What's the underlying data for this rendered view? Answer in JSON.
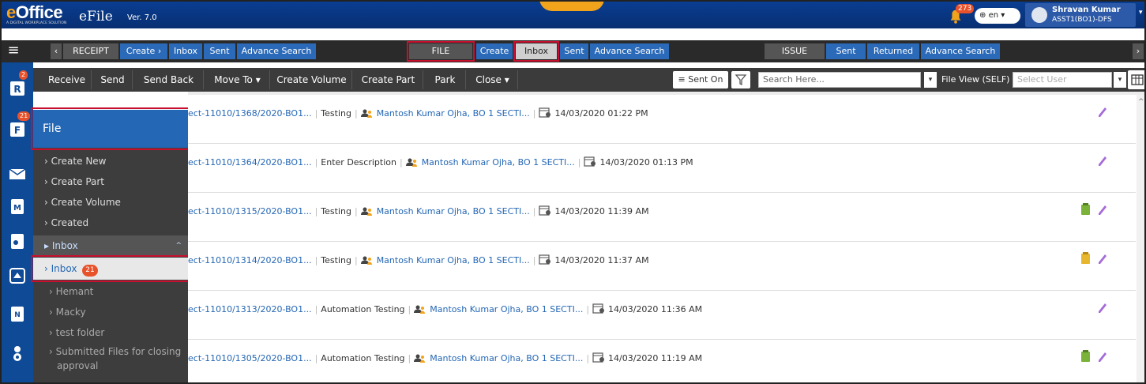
{
  "header": {
    "brand_e": "e",
    "brand_rest": "Office",
    "tagline": "A DIGITAL WORKPLACE SOLUTION",
    "product": "eFile",
    "version": "Ver. 7.0",
    "notifications": "273",
    "language": "en",
    "user_name": "Shravan Kumar",
    "user_role": "ASST1(BO1)-DFS"
  },
  "nav": {
    "receipt": "RECEIPT",
    "receipt_create": "Create ›",
    "receipt_inbox": "Inbox",
    "receipt_sent": "Sent",
    "receipt_adv": "Advance Search",
    "file": "FILE",
    "file_create": "Create",
    "file_inbox": "Inbox",
    "file_sent": "Sent",
    "file_adv": "Advance Search",
    "issue": "ISSUE",
    "issue_sent": "Sent",
    "issue_returned": "Returned",
    "issue_adv": "Advance Search"
  },
  "toolbar": {
    "receive": "Receive",
    "send": "Send",
    "send_back": "Send Back",
    "move_to": "Move To ▾",
    "create_volume": "Create Volume",
    "create_part": "Create Part",
    "park": "Park",
    "close": "Close ▾",
    "sent_on": "Sent On",
    "search_placeholder": "Search Here...",
    "file_view": "File View (SELF)",
    "select_user": "Select User"
  },
  "iconbar": {
    "receipt_badge": "2",
    "file_badge": "21"
  },
  "sidemenu": {
    "title": "File",
    "create_new": "Create New",
    "create_part": "Create Part",
    "create_volume": "Create Volume",
    "created": "Created",
    "inbox": "Inbox",
    "inbox_sub": "Inbox",
    "inbox_count": "21",
    "hemant": "Hemant",
    "macky": "Macky",
    "test_folder": "test folder",
    "submitted_1": "Submitted Files for closing",
    "submitted_2": "approval"
  },
  "rows": [
    {
      "file_no": "ect-11010/1368/2020-BO1...",
      "subject": "Testing",
      "sender": "Mantosh Kumar Ojha, BO 1 SECTI...",
      "date": "14/03/2020 01:22 PM",
      "green_note": false,
      "yellow_note": false
    },
    {
      "file_no": "ect-11010/1364/2020-BO1...",
      "subject": "Enter Description",
      "sender": "Mantosh Kumar Ojha, BO 1 SECTI...",
      "date": "14/03/2020 01:13 PM",
      "green_note": false,
      "yellow_note": false
    },
    {
      "file_no": "ect-11010/1315/2020-BO1...",
      "subject": "Testing",
      "sender": "Mantosh Kumar Ojha, BO 1 SECTI...",
      "date": "14/03/2020 11:39 AM",
      "green_note": true,
      "yellow_note": false
    },
    {
      "file_no": "ect-11010/1314/2020-BO1...",
      "subject": "Testing",
      "sender": "Mantosh Kumar Ojha, BO 1 SECTI...",
      "date": "14/03/2020 11:37 AM",
      "green_note": false,
      "yellow_note": true
    },
    {
      "file_no": "ect-11010/1313/2020-BO1...",
      "subject": "Automation Testing",
      "sender": "Mantosh Kumar Ojha, BO 1 SECTI...",
      "date": "14/03/2020 11:36 AM",
      "green_note": false,
      "yellow_note": false
    },
    {
      "file_no": "ect-11010/1305/2020-BO1...",
      "subject": "Automation Testing",
      "sender": "Mantosh Kumar Ojha, BO 1 SECTI...",
      "date": "14/03/2020 11:19 AM",
      "green_note": true,
      "yellow_note": false
    }
  ],
  "colors": {
    "header_blue": "#0a3d91",
    "accent_blue": "#2467b5",
    "highlight_red": "#c8102e",
    "attach_purple": "#a56cd9"
  }
}
